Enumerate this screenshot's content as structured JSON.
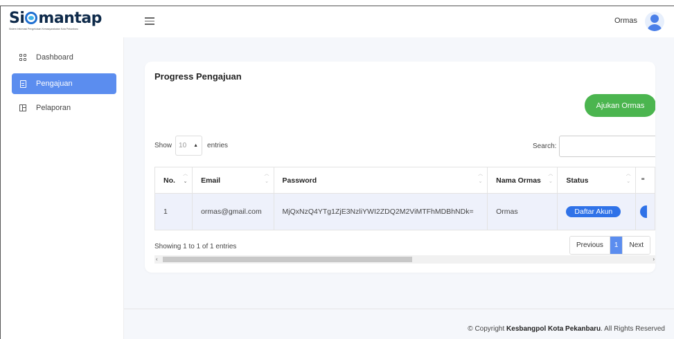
{
  "brand": {
    "name_left": "Si",
    "name_right": "mantap",
    "subtitle": "Sistem Informasi Pengelolaan Kemasyarakatan Kota Pekanbaru"
  },
  "header": {
    "user_name": "Ormas"
  },
  "sidebar": {
    "items": [
      {
        "label": "Dashboard",
        "icon": "grid-icon",
        "active": false
      },
      {
        "label": "Pengajuan",
        "icon": "document-icon",
        "active": true
      },
      {
        "label": "Pelaporan",
        "icon": "report-icon",
        "active": false
      }
    ]
  },
  "card": {
    "title": "Progress Pengajuan",
    "add_button": "Ajukan Ormas",
    "show_label": "Show",
    "entries_label": "entries",
    "page_size": "10",
    "search_label": "Search:",
    "search_value": "",
    "info": "Showing 1 to 1 of 1 entries"
  },
  "table": {
    "columns": [
      "No.",
      "Email",
      "Password",
      "Nama Ormas",
      "Status"
    ],
    "rows": [
      {
        "no": "1",
        "email": "ormas@gmail.com",
        "password": "MjQxNzQ4YTg1ZjE3NzliYWI2ZDQ2M2ViMTFhMDBhNDk=",
        "nama_ormas": "Ormas",
        "status": "Daftar Akun"
      }
    ]
  },
  "pagination": {
    "previous": "Previous",
    "current": "1",
    "next": "Next"
  },
  "footer": {
    "prefix": "© Copyright ",
    "org": "Kesbangpol Kota Pekanbaru",
    "suffix": ". All Rights Reserved"
  },
  "colors": {
    "primary": "#5b8def",
    "success": "#4bb54f",
    "badge": "#2f72e8",
    "brand_dark": "#0e2a4a"
  }
}
